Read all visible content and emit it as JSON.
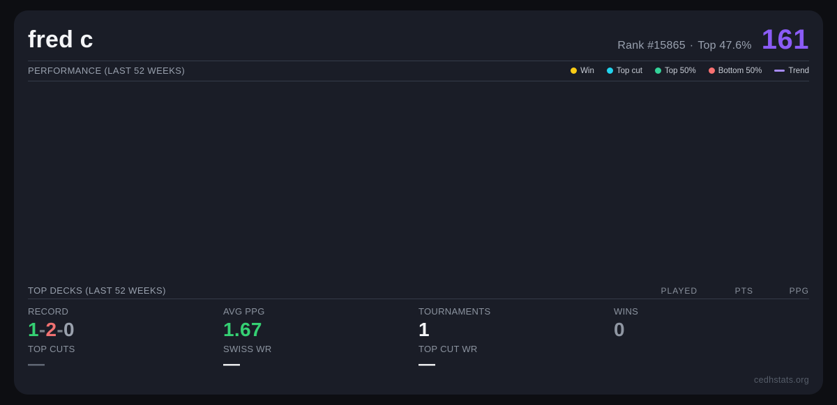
{
  "player": {
    "name": "fred c",
    "rank_label": "Rank #15865",
    "separator": "·",
    "top_percent": "Top 47.6%",
    "score": "161"
  },
  "performance": {
    "title": "PERFORMANCE (LAST 52 WEEKS)",
    "legend": [
      {
        "label": "Win",
        "color": "#facc15",
        "marker": "dot"
      },
      {
        "label": "Top cut",
        "color": "#22d3ee",
        "marker": "dot"
      },
      {
        "label": "Top 50%",
        "color": "#34d399",
        "marker": "dot"
      },
      {
        "label": "Bottom 50%",
        "color": "#f87171",
        "marker": "dot"
      },
      {
        "label": "Trend",
        "color": "#a78bfa",
        "marker": "line"
      }
    ],
    "chart_empty": true
  },
  "top_decks": {
    "title": "TOP DECKS (LAST 52 WEEKS)",
    "columns": [
      "PLAYED",
      "PTS",
      "PPG"
    ],
    "rows": []
  },
  "stats": {
    "record": {
      "label": "RECORD",
      "wins": "1",
      "losses": "2",
      "draws": "0",
      "sep": "-"
    },
    "avg_ppg": {
      "label": "AVG PPG",
      "value": "1.67"
    },
    "tournaments": {
      "label": "TOURNAMENTS",
      "value": "1"
    },
    "wins": {
      "label": "WINS",
      "value": "0"
    },
    "top_cuts": {
      "label": "TOP CUTS",
      "value": "—"
    },
    "swiss_wr": {
      "label": "SWISS WR",
      "value": "—"
    },
    "top_cut_wr": {
      "label": "TOP CUT WR",
      "value": "—"
    }
  },
  "footer": {
    "watermark": "cedhstats.org"
  },
  "colors": {
    "page_background": "#0d0e12",
    "card_background": "#1a1d27",
    "divider": "#353b49",
    "title_text": "#f4f5f7",
    "muted_text": "#8b939f",
    "score_accent": "#8b5cf6",
    "win_green": "#35d073",
    "loss_red": "#f07171",
    "neutral_gray": "#9aa1ad"
  }
}
